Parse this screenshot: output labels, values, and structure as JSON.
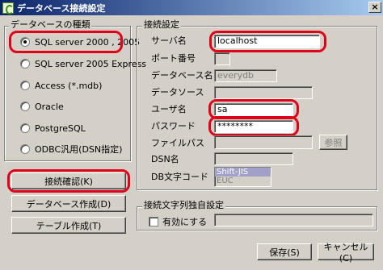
{
  "window": {
    "title": "データベース接続設定",
    "close_label": "×"
  },
  "db_type_group": {
    "legend": "データベースの種類",
    "options": [
      {
        "label": "SQL server 2000 , 2005",
        "checked": true
      },
      {
        "label": "SQL server 2005 Express",
        "checked": false
      },
      {
        "label": "Access (*.mdb)",
        "checked": false
      },
      {
        "label": "Oracle",
        "checked": false
      },
      {
        "label": "PostgreSQL",
        "checked": false
      },
      {
        "label": "ODBC汎用(DSN指定)",
        "checked": false
      }
    ]
  },
  "buttons": {
    "test_connection": "接続確認(K)",
    "create_database": "データベース作成(D)",
    "create_table": "テーブル作成(T)",
    "browse": "参照",
    "save": "保存(S)",
    "cancel": "キャンセル(C)"
  },
  "connection_group": {
    "legend": "接続設定",
    "server_label": "サーバ名",
    "server_value": "localhost",
    "port_label": "ポート番号",
    "port_value": "",
    "dbname_label": "データベース名",
    "dbname_value": "everydb",
    "datasource_label": "データソース",
    "datasource_value": "",
    "user_label": "ユーザ名",
    "user_value": "sa",
    "password_label": "パスワード",
    "password_value": "********",
    "filepath_label": "ファイルパス",
    "filepath_value": "",
    "dsn_label": "DSN名",
    "dsn_value": "",
    "charset_label": "DB文字コード",
    "charset_options": [
      "Shift-JIS",
      "EUC"
    ]
  },
  "custom_group": {
    "legend": "接続文字列独自設定",
    "enable_label": "有効にする",
    "enable_checked": false,
    "value": ""
  },
  "colors": {
    "highlight_ring": "#e0001a",
    "window_bg": "#d4d0c8",
    "title_start": "#0a246a",
    "title_end": "#a6caf0"
  }
}
